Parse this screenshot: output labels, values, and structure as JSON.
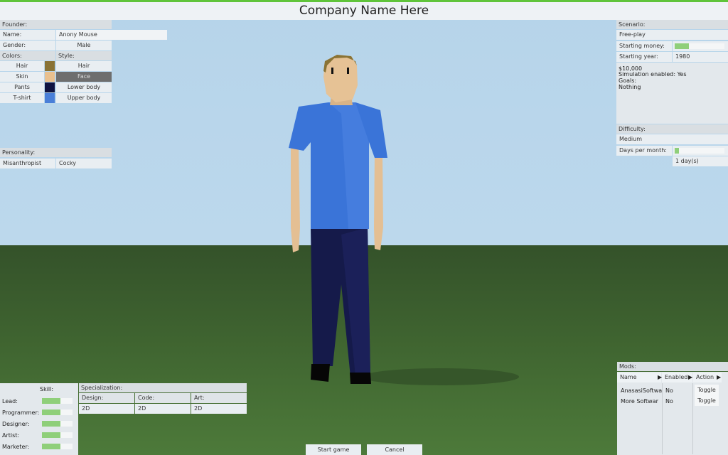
{
  "title": "Company Name Here",
  "founder": {
    "header": "Founder:",
    "name_label": "Name:",
    "name_value": "Anony Mouse",
    "gender_label": "Gender:",
    "gender_value": "Male",
    "colors_label": "Colors:",
    "style_label": "Style:",
    "rows": [
      {
        "color_label": "Hair",
        "swatch": "#8a7335",
        "style": "Hair"
      },
      {
        "color_label": "Skin",
        "swatch": "#e9c08e",
        "style": "Face"
      },
      {
        "color_label": "Pants",
        "swatch": "#0f1240",
        "style": "Lower body"
      },
      {
        "color_label": "T-shirt",
        "swatch": "#4a7fd8",
        "style": "Upper body"
      }
    ],
    "personality_label": "Personality:",
    "personality_1": "Misanthropist",
    "personality_2": "Cocky"
  },
  "scenario": {
    "header": "Scenario:",
    "value": "Free-play",
    "money_label": "Starting money:",
    "money_level": 0.28,
    "year_label": "Starting year:",
    "year_value": "1980",
    "desc_money": "$10,000",
    "desc_sim": "Simulation enabled: Yes",
    "desc_goals": "Goals:",
    "desc_nothing": "Nothing",
    "difficulty_label": "Difficulty:",
    "difficulty_value": "Medium",
    "days_label": "Days per month:",
    "days_level": 0.08,
    "days_value": "1 day(s)"
  },
  "skills": {
    "header": "Skill:",
    "items": [
      {
        "label": "Lead:",
        "level": 0.6
      },
      {
        "label": "Programmer:",
        "level": 0.6
      },
      {
        "label": "Designer:",
        "level": 0.6
      },
      {
        "label": "Artist:",
        "level": 0.6
      },
      {
        "label": "Marketer:",
        "level": 0.6
      }
    ]
  },
  "specialization": {
    "header": "Specialization:",
    "columns": [
      "Design:",
      "Code:",
      "Art:"
    ],
    "values": [
      "2D",
      "2D",
      "2D"
    ]
  },
  "mods": {
    "header": "Mods:",
    "columns": [
      "Name",
      "Enabled",
      "Action"
    ],
    "rows": [
      {
        "name": "AnasasiSoftwa",
        "enabled": "No",
        "action": "Toggle"
      },
      {
        "name": "More Softwar",
        "enabled": "No",
        "action": "Toggle"
      }
    ]
  },
  "buttons": {
    "start": "Start game",
    "cancel": "Cancel"
  },
  "colors": {
    "accent": "#5fc43a",
    "skill_fill": "#8fcf7a"
  }
}
